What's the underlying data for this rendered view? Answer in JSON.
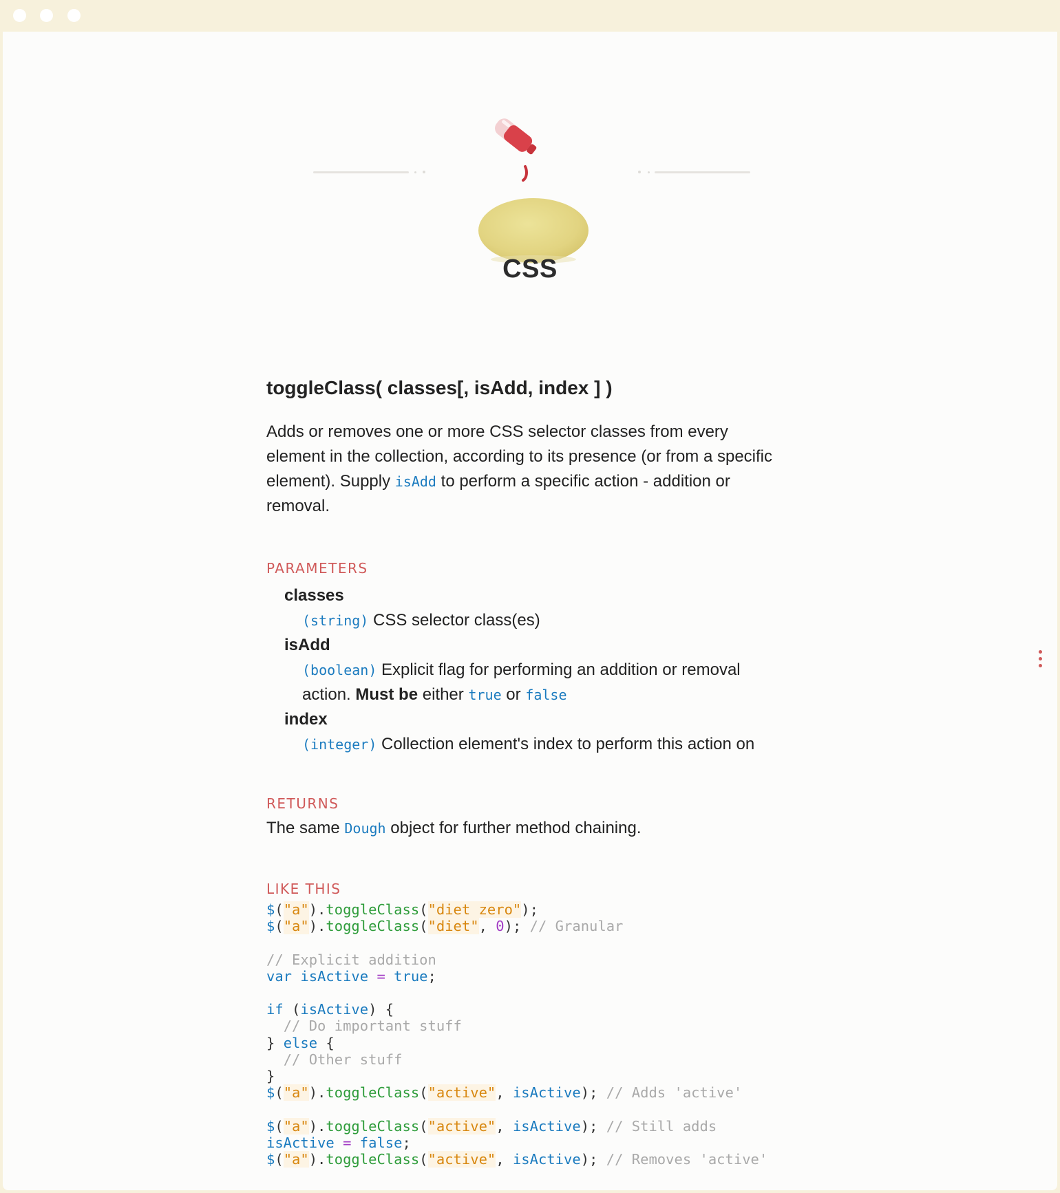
{
  "page": {
    "title": "CSS",
    "hero_icon": "dough-with-glue-bottle-icon"
  },
  "method": {
    "signature": "toggleClass( classes[, isAdd, index ] )",
    "description": {
      "part1": "Adds or removes one or more CSS selector classes from every element in the collection, according to its presence (or from a specific element). Supply ",
      "code": "isAdd",
      "part2": " to perform a specific action - addition or removal."
    }
  },
  "parameters": {
    "label": "PARAMETERS",
    "items": [
      {
        "name": "classes",
        "type": "(string)",
        "text": "CSS selector class(es)"
      },
      {
        "name": "isAdd",
        "type": "(boolean)",
        "text1": "Explicit flag for performing an addition or removal action.",
        "bold": "Must be",
        "text2": "either",
        "code1": "true",
        "text3": "or",
        "code2": "false"
      },
      {
        "name": "index",
        "type": "(integer)",
        "text": "Collection element's index to perform this action on"
      }
    ]
  },
  "returns": {
    "label": "RETURNS",
    "prefix": "The same ",
    "code": "Dough",
    "suffix": " object for further method chaining."
  },
  "example": {
    "label": "LIKE THIS",
    "lines": [
      "$(\"a\").toggleClass(\"diet zero\");",
      "$(\"a\").toggleClass(\"diet\", 0); // Granular",
      "",
      "// Explicit addition",
      "var isActive = true;",
      "",
      "if (isActive) {",
      "  // Do important stuff",
      "} else {",
      "  // Other stuff",
      "}",
      "$(\"a\").toggleClass(\"active\", isActive); // Adds 'active'",
      "",
      "$(\"a\").toggleClass(\"active\", isActive); // Still adds",
      "isActive = false;",
      "$(\"a\").toggleClass(\"active\", isActive); // Removes 'active'"
    ]
  },
  "ui": {
    "menu_icon": "more-vertical-icon",
    "accent_color": "#d05a5a",
    "code_color": "#1b7bbf"
  }
}
